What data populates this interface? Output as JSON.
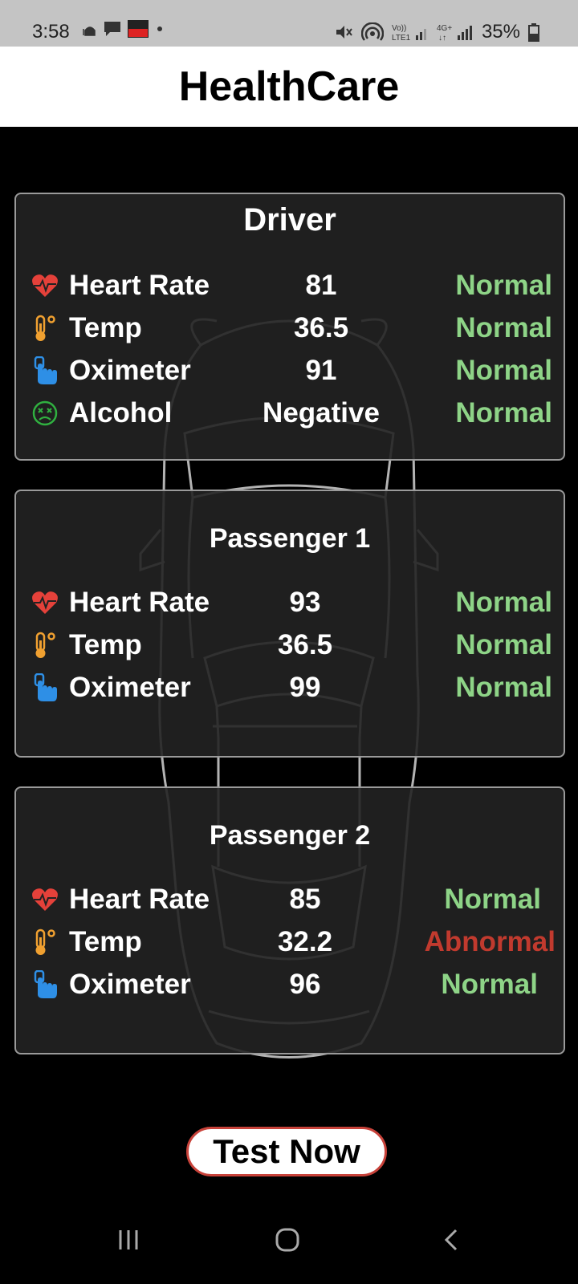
{
  "status_bar": {
    "time": "3:58",
    "battery": "35%",
    "icons": [
      "mosque-icon",
      "message-icon",
      "app-thumbnail-icon",
      "dot-icon",
      "mute-icon",
      "hotspot-icon",
      "volte-signal-icon",
      "4g-signal-icon",
      "battery-icon"
    ]
  },
  "app": {
    "title": "HealthCare"
  },
  "cards": [
    {
      "title": "Driver",
      "rows": [
        {
          "icon": "heart-rate-icon",
          "label": "Heart Rate",
          "value": "81",
          "status": "Normal",
          "status_color": "#8ed487"
        },
        {
          "icon": "thermometer-icon",
          "label": "Temp",
          "value": "36.5",
          "status": "Normal",
          "status_color": "#8ed487"
        },
        {
          "icon": "oximeter-icon",
          "label": "Oximeter",
          "value": "91",
          "status": "Normal",
          "status_color": "#8ed487"
        },
        {
          "icon": "alcohol-face-icon",
          "label": "Alcohol",
          "value": "Negative",
          "status": "Normal",
          "status_color": "#8ed487"
        }
      ]
    },
    {
      "title": "Passenger 1",
      "rows": [
        {
          "icon": "heart-rate-icon",
          "label": "Heart Rate",
          "value": "93",
          "status": "Normal",
          "status_color": "#8ed487"
        },
        {
          "icon": "thermometer-icon",
          "label": "Temp",
          "value": "36.5",
          "status": "Normal",
          "status_color": "#8ed487"
        },
        {
          "icon": "oximeter-icon",
          "label": "Oximeter",
          "value": "99",
          "status": "Normal",
          "status_color": "#8ed487"
        }
      ]
    },
    {
      "title": "Passenger 2",
      "rows": [
        {
          "icon": "heart-rate-icon",
          "label": "Heart Rate",
          "value": "85",
          "status": "Normal",
          "status_color": "#8ed487"
        },
        {
          "icon": "thermometer-icon",
          "label": "Temp",
          "value": "32.2",
          "status": "Abnormal",
          "status_color": "#c13a2e"
        },
        {
          "icon": "oximeter-icon",
          "label": "Oximeter",
          "value": "96",
          "status": "Normal",
          "status_color": "#8ed487"
        }
      ]
    }
  ],
  "actions": {
    "test_label": "Test Now"
  },
  "nav_bar": {
    "icons": [
      "recents-icon",
      "home-icon",
      "back-icon"
    ]
  },
  "colors": {
    "accent_red": "#c8423a",
    "normal_green": "#8ed487",
    "abnormal_red": "#c13a2e",
    "background": "#000000"
  }
}
